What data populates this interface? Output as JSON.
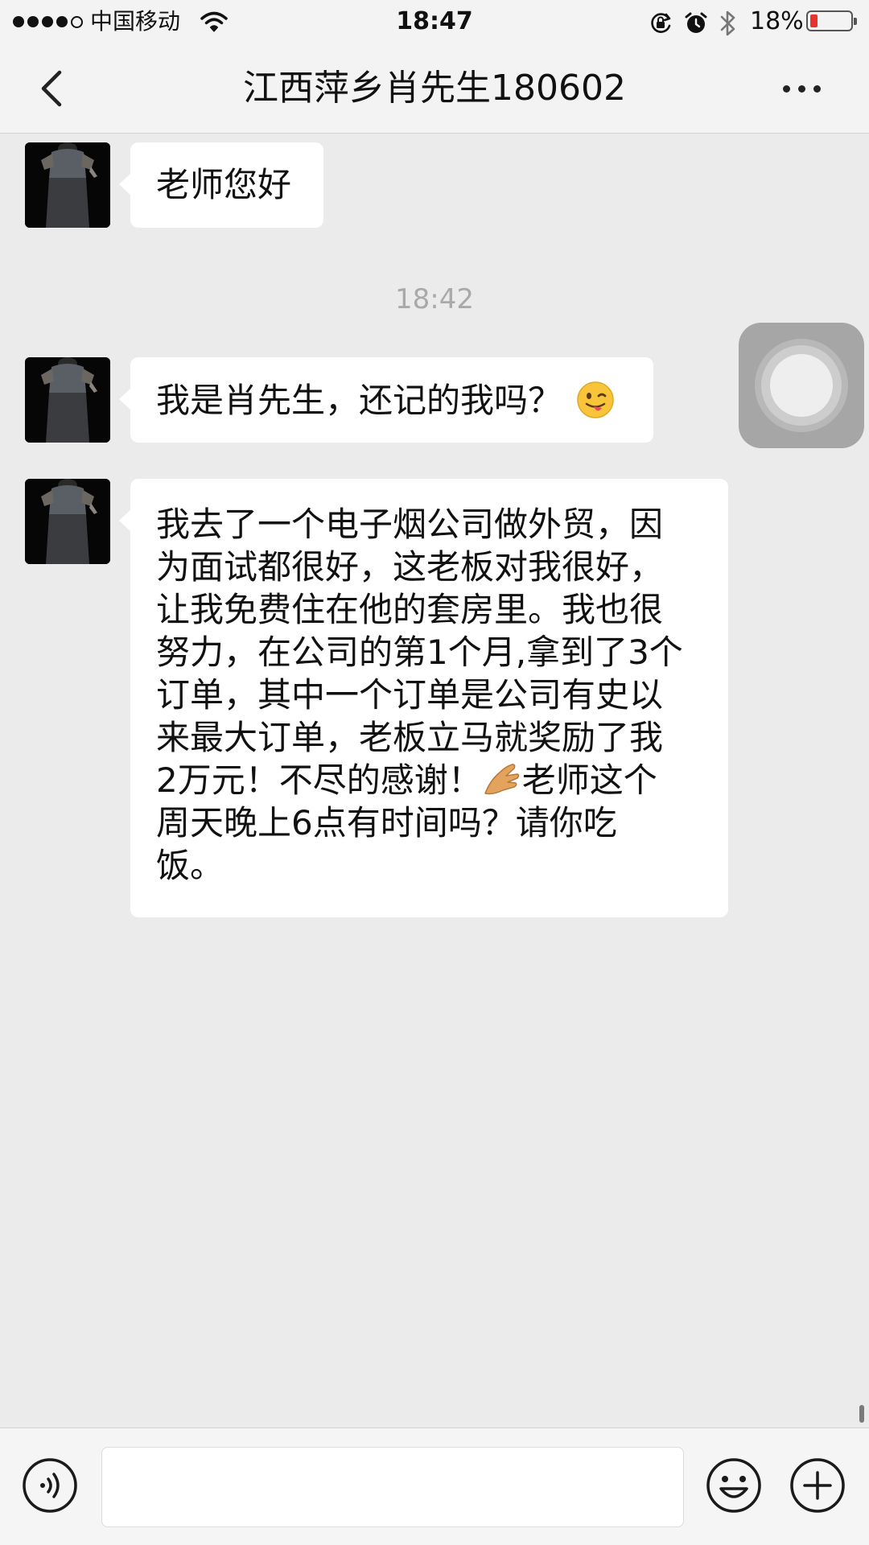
{
  "status_bar": {
    "carrier": "中国移动",
    "time": "18:47",
    "battery_percent": "18%",
    "battery_level": 0.18,
    "battery_color": "#e8322b",
    "signal_bars_filled": 4,
    "signal_bars_total": 5,
    "icons": [
      "wifi-icon",
      "rotation-lock-icon",
      "alarm-icon",
      "bluetooth-icon",
      "battery-icon"
    ]
  },
  "nav": {
    "title": "江西萍乡肖先生180602",
    "back_icon": "chevron-left-icon",
    "more_icon": "more-dots-icon"
  },
  "chat": {
    "messages": [
      {
        "sender": "contact",
        "text": "老师您好"
      },
      {
        "timestamp": "18:42"
      },
      {
        "sender": "contact",
        "text": "我是肖先生，还记的我吗？",
        "emoji": "winking-face-tongue-emoji"
      },
      {
        "sender": "contact",
        "lines": [
          "我去了一个电子烟公司做外贸，因",
          "为面试都很好，这老板对我很好，",
          "让我免费住在他的套房里。我也很",
          "努力，在公司的第1个月,拿到了3个",
          "订单，其中一个订单是公司有史以",
          "来最大订单，老板立马就奖励了我",
          "2万元！不尽的感谢！",
          "老师这个",
          "周天晚上6点有时间吗？请你吃",
          "饭。"
        ],
        "emoji": "pinching-hand-emoji"
      }
    ]
  },
  "input_bar": {
    "value": "",
    "voice_icon": "voice-icon",
    "emoji_icon": "emoji-smile-icon",
    "plus_icon": "plus-icon"
  },
  "colors": {
    "chat_background": "#ebebeb",
    "bubble_background": "#ffffff",
    "timestamp_text": "#a9a9a9",
    "bar_background": "#f3f3f3"
  }
}
